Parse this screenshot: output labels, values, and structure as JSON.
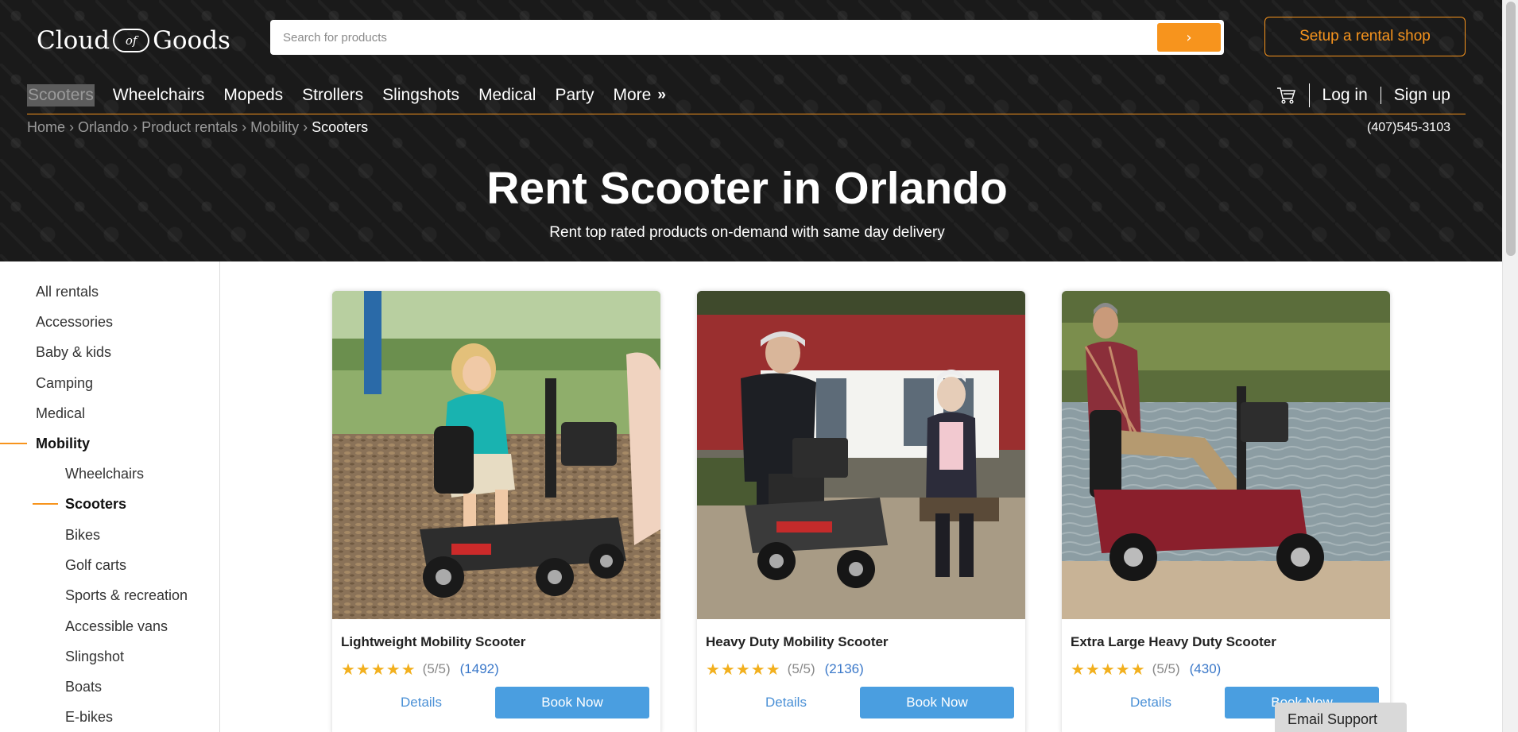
{
  "header": {
    "logo_left": "Cloud",
    "logo_mid": "of",
    "logo_right": "Goods",
    "search_placeholder": "Search for products",
    "search_button": "›",
    "setup_button": "Setup a rental shop"
  },
  "nav": {
    "items": [
      {
        "label": "Scooters",
        "active": true
      },
      {
        "label": "Wheelchairs"
      },
      {
        "label": "Mopeds"
      },
      {
        "label": "Strollers"
      },
      {
        "label": "Slingshots"
      },
      {
        "label": "Medical"
      },
      {
        "label": "Party"
      }
    ],
    "more_label": "More",
    "more_icon": "»",
    "login": "Log in",
    "signup": "Sign up"
  },
  "breadcrumb": [
    "Home",
    "Orlando",
    "Product rentals",
    "Mobility",
    "Scooters"
  ],
  "breadcrumb_separator": "›",
  "phone": "(407)545-3103",
  "hero": {
    "title": "Rent Scooter in Orlando",
    "subtitle": "Rent top rated products on-demand with same day delivery"
  },
  "sidebar": {
    "items": [
      {
        "label": "All rentals"
      },
      {
        "label": "Accessories"
      },
      {
        "label": "Baby & kids"
      },
      {
        "label": "Camping"
      },
      {
        "label": "Medical"
      },
      {
        "label": "Mobility",
        "active": true
      },
      {
        "label": "Wheelchairs",
        "sub": true
      },
      {
        "label": "Scooters",
        "sub": true,
        "active": true
      },
      {
        "label": "Bikes",
        "sub": true
      },
      {
        "label": "Golf carts",
        "sub": true
      },
      {
        "label": "Sports & recreation",
        "sub": true
      },
      {
        "label": "Accessible vans",
        "sub": true
      },
      {
        "label": "Slingshot",
        "sub": true
      },
      {
        "label": "Boats",
        "sub": true
      },
      {
        "label": "E-bikes",
        "sub": true
      }
    ]
  },
  "products": [
    {
      "title": "Lightweight Mobility Scooter",
      "stars": "★★★★★",
      "score": "(5/5)",
      "reviews": "(1492)",
      "details": "Details",
      "book": "Book Now"
    },
    {
      "title": "Heavy Duty Mobility Scooter",
      "stars": "★★★★★",
      "score": "(5/5)",
      "reviews": "(2136)",
      "details": "Details",
      "book": "Book Now"
    },
    {
      "title": "Extra Large Heavy Duty Scooter",
      "stars": "★★★★★",
      "score": "(5/5)",
      "reviews": "(430)",
      "details": "Details",
      "book": "Book Now"
    }
  ],
  "email_support": "Email Support",
  "colors": {
    "accent": "#f7941d",
    "button_blue": "#4a9ee0",
    "star": "#f2b01e"
  }
}
